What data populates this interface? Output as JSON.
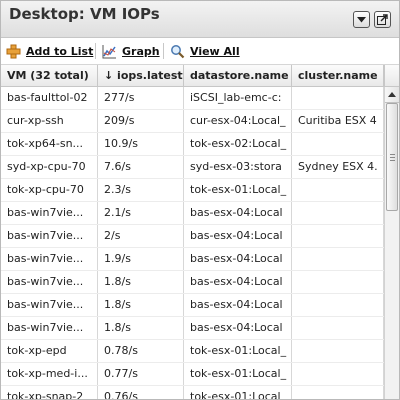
{
  "header": {
    "title": "Desktop: VM IOPs"
  },
  "toolbar": {
    "add_to_list": "Add to List",
    "graph": "Graph",
    "view_all": "View All"
  },
  "table": {
    "columns": [
      "VM (32 total)",
      "↓ iops.latest",
      "datastore.name",
      "cluster.name"
    ],
    "rows": [
      [
        "bas-faulttol-02",
        "277/s",
        "iSCSI_lab-emc-c:",
        ""
      ],
      [
        "cur-xp-ssh",
        "209/s",
        "cur-esx-04:Local_",
        "Curitiba ESX 4"
      ],
      [
        "tok-xp64-sn...",
        "10.9/s",
        "tok-esx-02:Local_",
        ""
      ],
      [
        "syd-xp-cpu-70",
        "7.6/s",
        "syd-esx-03:stora",
        "Sydney ESX 4."
      ],
      [
        "tok-xp-cpu-70",
        "2.3/s",
        "tok-esx-01:Local_",
        ""
      ],
      [
        "bas-win7vie...",
        "2.1/s",
        "bas-esx-04:Local",
        ""
      ],
      [
        "bas-win7vie...",
        "2/s",
        "bas-esx-04:Local",
        ""
      ],
      [
        "bas-win7vie...",
        "1.9/s",
        "bas-esx-04:Local",
        ""
      ],
      [
        "bas-win7vie...",
        "1.8/s",
        "bas-esx-04:Local",
        ""
      ],
      [
        "bas-win7vie...",
        "1.8/s",
        "bas-esx-04:Local",
        ""
      ],
      [
        "bas-win7vie...",
        "1.8/s",
        "bas-esx-04:Local",
        ""
      ],
      [
        "tok-xp-epd",
        "0.78/s",
        "tok-esx-01:Local_",
        ""
      ],
      [
        "tok-xp-med-i...",
        "0.77/s",
        "tok-esx-01:Local_",
        ""
      ],
      [
        "tok-xp-snap-2",
        "0.76/s",
        "tok-esx-01:Local_",
        ""
      ]
    ]
  }
}
